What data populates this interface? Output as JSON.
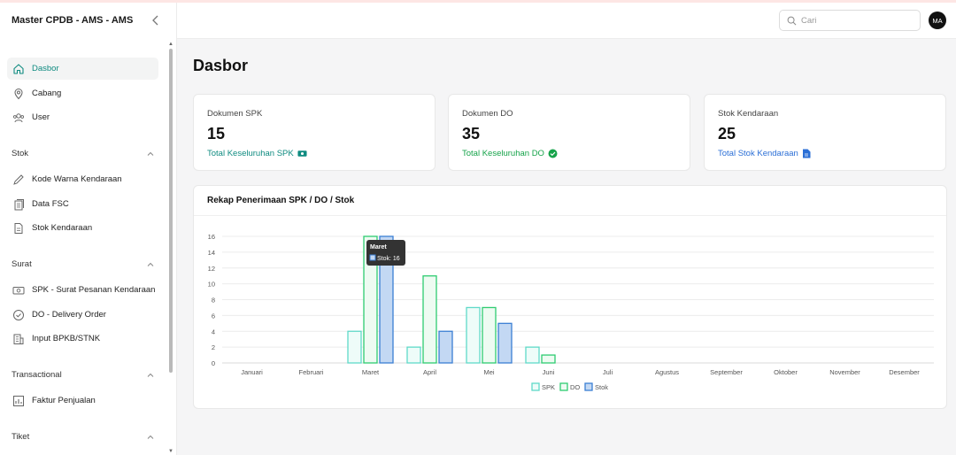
{
  "app": {
    "title": "Master CPDB - AMS - AMS"
  },
  "header": {
    "search_placeholder": "Cari",
    "avatar_initials": "MA"
  },
  "sidebar": {
    "items": [
      {
        "label": "Dasbor",
        "icon": "home-icon",
        "active": true
      },
      {
        "label": "Cabang",
        "icon": "map-pin-icon"
      },
      {
        "label": "User",
        "icon": "users-icon"
      }
    ],
    "sections": [
      {
        "title": "Stok",
        "items": [
          {
            "label": "Kode Warna Kendaraan",
            "icon": "pencil-icon"
          },
          {
            "label": "Data FSC",
            "icon": "documents-icon"
          },
          {
            "label": "Stok Kendaraan",
            "icon": "file-icon"
          }
        ]
      },
      {
        "title": "Surat",
        "items": [
          {
            "label": "SPK - Surat Pesanan Kendaraan",
            "icon": "money-icon"
          },
          {
            "label": "DO - Delivery Order",
            "icon": "check-circle-icon"
          },
          {
            "label": "Input BPKB/STNK",
            "icon": "building-icon"
          }
        ]
      },
      {
        "title": "Transactional",
        "items": [
          {
            "label": "Faktur Penjualan",
            "icon": "chart-icon"
          }
        ]
      },
      {
        "title": "Tiket",
        "items": []
      }
    ]
  },
  "page": {
    "title": "Dasbor"
  },
  "cards": [
    {
      "label": "Dokumen SPK",
      "value": "15",
      "link": "Total Keseluruhan SPK",
      "link_color": "#0f8b80",
      "icon": "money-icon"
    },
    {
      "label": "Dokumen DO",
      "value": "35",
      "link": "Total Keseluruhan DO",
      "link_color": "#16a34a",
      "icon": "check-circle-icon"
    },
    {
      "label": "Stok Kendaraan",
      "value": "25",
      "link": "Total Stok Kendaraan",
      "link_color": "#2b6fd6",
      "icon": "file-icon"
    }
  ],
  "chart_data": {
    "type": "bar",
    "title": "Rekap Penerimaan SPK / DO / Stok",
    "categories": [
      "Januari",
      "Februari",
      "Maret",
      "April",
      "Mei",
      "Juni",
      "Juli",
      "Agustus",
      "September",
      "Oktober",
      "November",
      "Desember"
    ],
    "series": [
      {
        "name": "SPK",
        "values": [
          0,
          0,
          4,
          2,
          7,
          2,
          0,
          0,
          0,
          0,
          0,
          0
        ],
        "stroke": "#5fd9c8",
        "fill": "#eefcf9"
      },
      {
        "name": "DO",
        "values": [
          0,
          0,
          16,
          11,
          7,
          1,
          0,
          0,
          0,
          0,
          0,
          0
        ],
        "stroke": "#2ecc71",
        "fill": "#eefbf2"
      },
      {
        "name": "Stok",
        "values": [
          0,
          0,
          16,
          4,
          5,
          0,
          0,
          0,
          0,
          0,
          0,
          0
        ],
        "stroke": "#3b7fd4",
        "fill": "#c3d8f3"
      }
    ],
    "y_ticks": [
      0,
      2,
      4,
      6,
      8,
      10,
      12,
      14,
      16
    ],
    "ylim": [
      0,
      16
    ],
    "grid": true,
    "legend": "bottom",
    "tooltip": {
      "title": "Maret",
      "text": "Stok: 16"
    }
  }
}
